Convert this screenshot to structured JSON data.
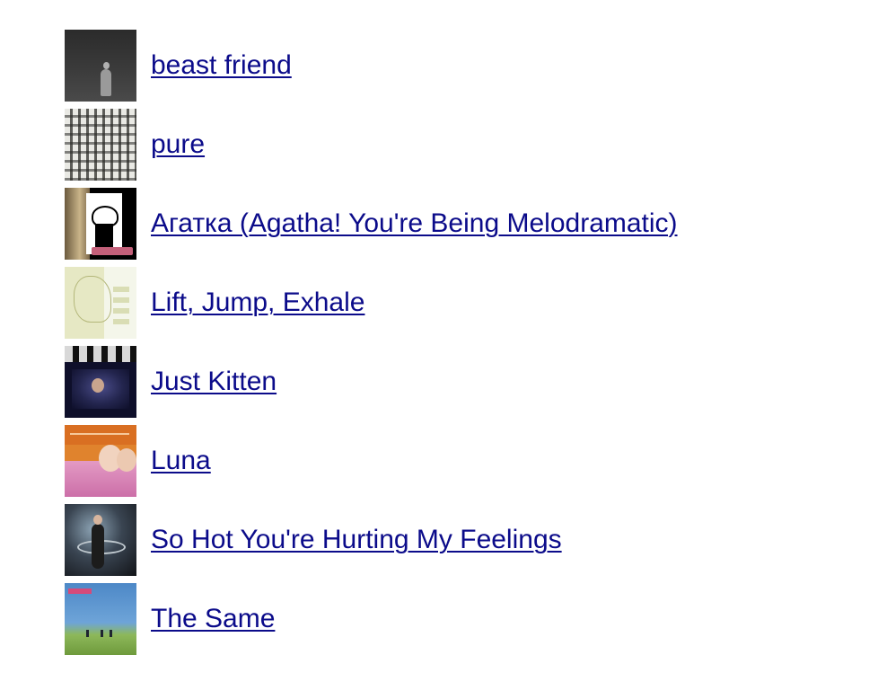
{
  "tracks": [
    {
      "title": "beast friend",
      "cover": "beast-friend-cover"
    },
    {
      "title": "pure",
      "cover": "pure-cover"
    },
    {
      "title": "Агатка (Agatha! You're Being Melodramatic)",
      "cover": "agatka-cover"
    },
    {
      "title": "Lift, Jump, Exhale",
      "cover": "lift-jump-exhale-cover"
    },
    {
      "title": "Just Kitten",
      "cover": "just-kitten-cover"
    },
    {
      "title": "Luna",
      "cover": "luna-cover"
    },
    {
      "title": "So Hot You're Hurting My Feelings",
      "cover": "so-hot-cover"
    },
    {
      "title": "The Same",
      "cover": "the-same-cover"
    }
  ],
  "colors": {
    "link": "#0b0b8a",
    "background": "#ffffff"
  }
}
